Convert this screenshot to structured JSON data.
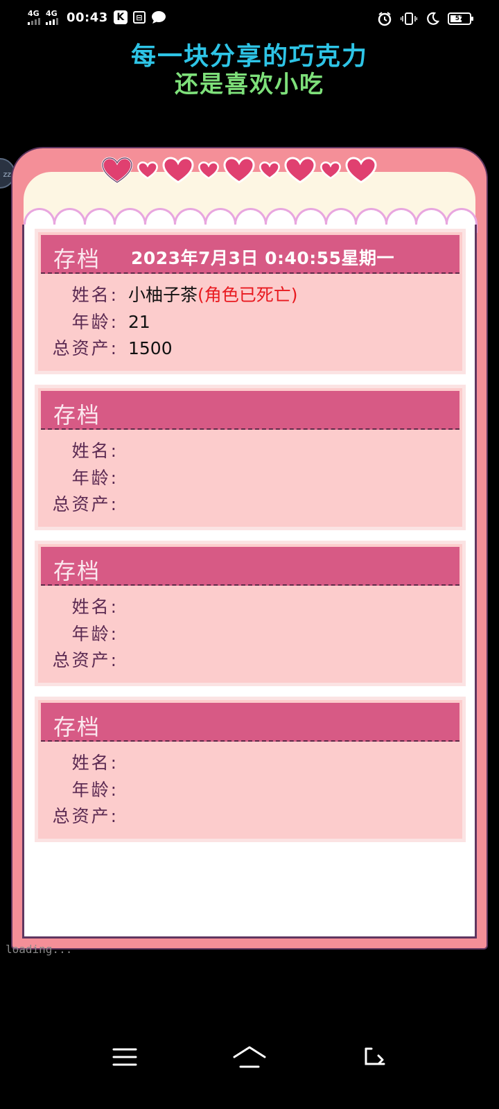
{
  "status_bar": {
    "network_1": "4G",
    "network_2": "4G",
    "time": "00:43",
    "battery_level": "57"
  },
  "header": {
    "line1": "每一块分享的巧克力",
    "line2": "还是喜欢小吃"
  },
  "side_bubble": "zz",
  "colors": {
    "frame": "#f48f98",
    "slot_header": "#d75a85",
    "slot_body": "#fccccc",
    "dead_text": "#e8191f",
    "title1": "#2ec4e6",
    "title2": "#7ee07a"
  },
  "labels": {
    "name": "姓名:",
    "age": "年龄:",
    "assets": "总资产:"
  },
  "save_slots": [
    {
      "title": "存档",
      "datetime": "2023年7月3日 0:40:55星期一",
      "name": "小柚子茶",
      "status": "(角色已死亡)",
      "age": "21",
      "assets": "1500"
    },
    {
      "title": "存档",
      "datetime": "",
      "name": "",
      "status": "",
      "age": "",
      "assets": ""
    },
    {
      "title": "存档",
      "datetime": "",
      "name": "",
      "status": "",
      "age": "",
      "assets": ""
    },
    {
      "title": "存档",
      "datetime": "",
      "name": "",
      "status": "",
      "age": "",
      "assets": ""
    }
  ],
  "loading_text": "loading...",
  "navbar": {
    "icons": [
      "menu-icon",
      "home-icon",
      "back-icon"
    ]
  }
}
